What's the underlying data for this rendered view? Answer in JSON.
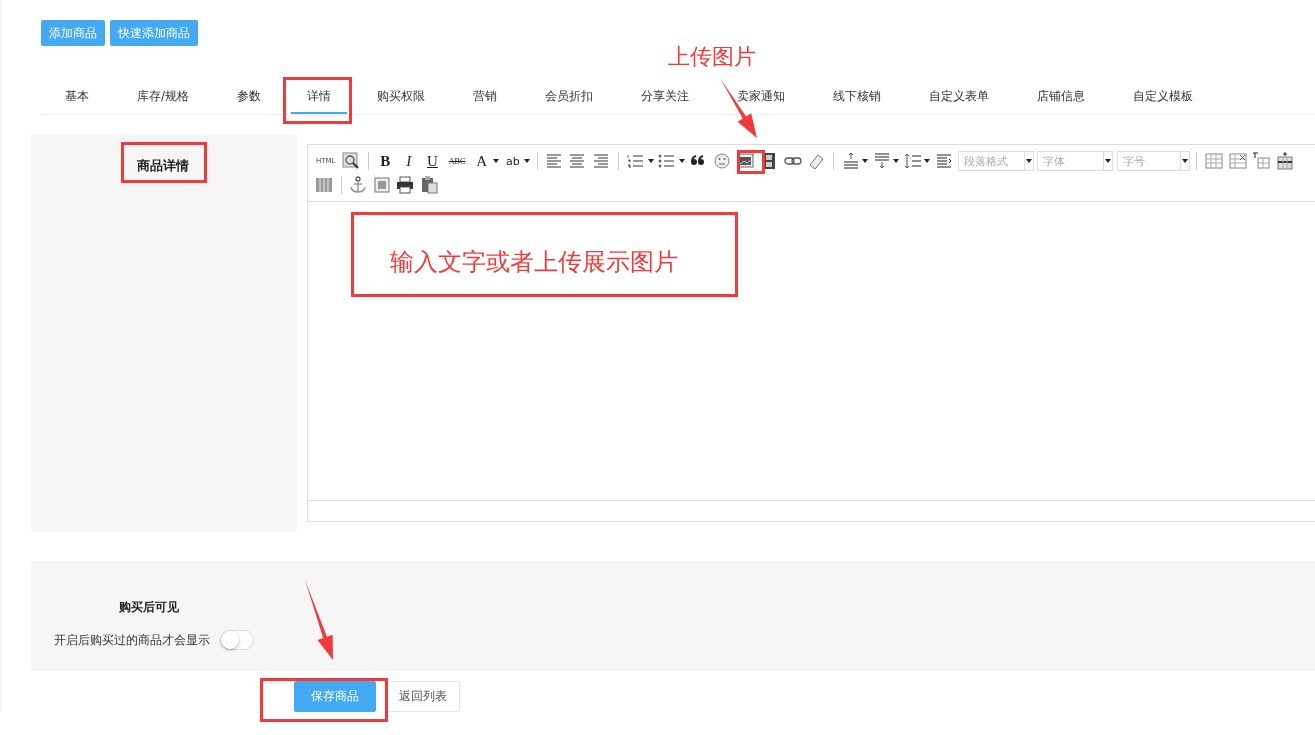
{
  "top_buttons": [
    "添加商品",
    "快速添加商品"
  ],
  "tabs": [
    {
      "label": "基本",
      "selected": false
    },
    {
      "label": "库存/规格",
      "selected": false
    },
    {
      "label": "参数",
      "selected": false
    },
    {
      "label": "详情",
      "selected": true
    },
    {
      "label": "购买权限",
      "selected": false
    },
    {
      "label": "营销",
      "selected": false
    },
    {
      "label": "会员折扣",
      "selected": false
    },
    {
      "label": "分享关注",
      "selected": false
    },
    {
      "label": "卖家通知",
      "selected": false
    },
    {
      "label": "线下核销",
      "selected": false
    },
    {
      "label": "自定义表单",
      "selected": false
    },
    {
      "label": "店铺信息",
      "selected": false
    },
    {
      "label": "自定义模板",
      "selected": false
    }
  ],
  "detail_section": {
    "label": "商品详情",
    "editor": {
      "html_label": "HTML",
      "glyphs": [
        "B",
        "I",
        "U",
        "ABC",
        "A",
        "ab"
      ],
      "selects": [
        "段落格式",
        "字体",
        "字号"
      ]
    }
  },
  "visibility_section": {
    "title": "购买后可见",
    "toggle_label": "开启后购买过的商品才会显示",
    "toggle_on": false
  },
  "footer_buttons": [
    {
      "label": "保存商品",
      "kind": "primary"
    },
    {
      "label": "返回列表",
      "kind": "default"
    }
  ],
  "annotations": [
    {
      "kind": "box"
    },
    {
      "kind": "box"
    },
    {
      "kind": "box"
    },
    {
      "kind": "box"
    },
    {
      "kind": "box"
    },
    {
      "kind": "arrow"
    },
    {
      "kind": "arrow"
    },
    {
      "kind": "text",
      "text": "上传图片"
    },
    {
      "kind": "text",
      "text": "输入文字或者上传展示图片"
    }
  ]
}
